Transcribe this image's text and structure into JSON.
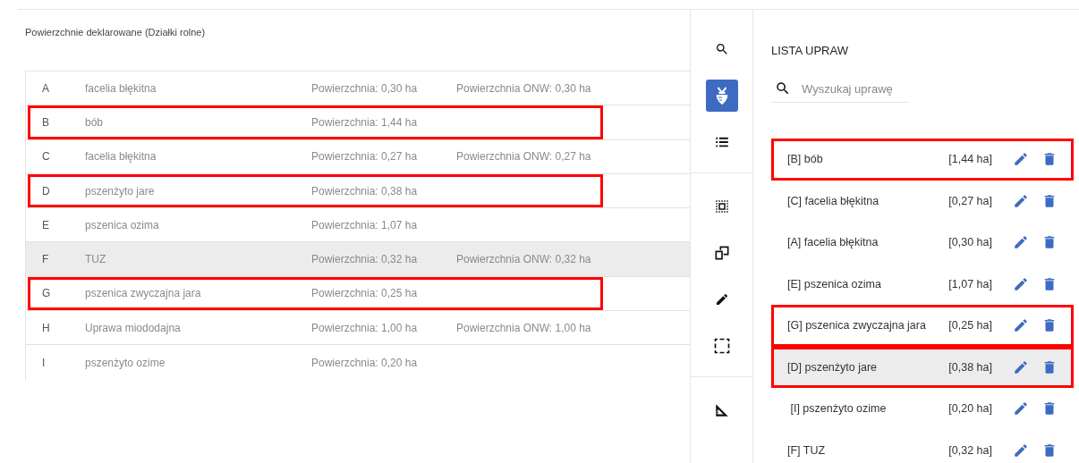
{
  "panel_title": "Powierzchnie deklarowane (Działki rolne)",
  "parcels": [
    {
      "letter": "A",
      "crop": "facelia błękitna",
      "area": "Powierzchnia: 0,30 ha",
      "onw_area": "Powierzchnia ONW: 0,30 ha",
      "marked": false,
      "hovered": false
    },
    {
      "letter": "B",
      "crop": "bób",
      "area": "Powierzchnia: 1,44 ha",
      "marked": true,
      "hovered": false
    },
    {
      "letter": "C",
      "crop": "facelia błękitna",
      "area": "Powierzchnia: 0,27 ha",
      "onw_area": "Powierzchnia ONW: 0,27 ha",
      "marked": false,
      "hovered": false
    },
    {
      "letter": "D",
      "crop": "pszenżyto jare",
      "area": "Powierzchnia: 0,38 ha",
      "marked": true,
      "hovered": false
    },
    {
      "letter": "E",
      "crop": "pszenica ozima",
      "area": "Powierzchnia: 1,07 ha",
      "marked": false,
      "hovered": false
    },
    {
      "letter": "F",
      "crop": "TUZ",
      "area": "Powierzchnia: 0,32 ha",
      "onw_area": "Powierzchnia ONW: 0,32 ha",
      "marked": false,
      "hovered": true
    },
    {
      "letter": "G",
      "crop": "pszenica zwyczajna jara",
      "area": "Powierzchnia: 0,25 ha",
      "marked": true,
      "hovered": false
    },
    {
      "letter": "H",
      "crop": "Uprawa miododajna",
      "area": "Powierzchnia: 1,00 ha",
      "onw_area": "Powierzchnia ONW: 1,00 ha",
      "marked": false,
      "hovered": false
    },
    {
      "letter": "I",
      "crop": "pszenżyto ozime",
      "area": "Powierzchnia: 0,20 ha",
      "marked": false,
      "hovered": false
    }
  ],
  "toolbar": [
    [
      {
        "kind": "search",
        "selected": false
      },
      {
        "kind": "crop",
        "selected": true
      },
      {
        "kind": "list",
        "selected": false
      }
    ],
    [
      {
        "kind": "select",
        "selected": false
      },
      {
        "kind": "copy",
        "selected": false
      },
      {
        "kind": "edit",
        "selected": false
      },
      {
        "kind": "rect",
        "selected": false
      }
    ],
    [
      {
        "kind": "measure",
        "selected": false
      }
    ]
  ],
  "crop_list": {
    "title": "LISTA UPRAW",
    "search": {
      "placeholder": "Wyszukaj uprawę"
    },
    "items": [
      {
        "label": "[B] bób",
        "area": "[1,44 ha]",
        "marked": true,
        "hovered": false
      },
      {
        "label": "[C] facelia błękitna",
        "area": "[0,27 ha]",
        "marked": false,
        "hovered": false
      },
      {
        "label": "[A] facelia błękitna",
        "area": "[0,30 ha]",
        "marked": false,
        "hovered": false
      },
      {
        "label": "[E] pszenica ozima",
        "area": "[1,07 ha]",
        "marked": false,
        "hovered": false
      },
      {
        "label": "[G] pszenica zwyczajna jara",
        "area": "[0,25 ha]",
        "marked": true,
        "hovered": false
      },
      {
        "label": "[D] pszenżyto jare",
        "area": "[0,38 ha]",
        "marked": true,
        "hovered": true
      },
      {
        "label": " [I] pszenżyto ozime",
        "area": "[0,20 ha]",
        "marked": false,
        "hovered": false
      },
      {
        "label": "[F] TUZ",
        "area": "[0,32 ha]",
        "marked": false,
        "hovered": false
      }
    ]
  }
}
